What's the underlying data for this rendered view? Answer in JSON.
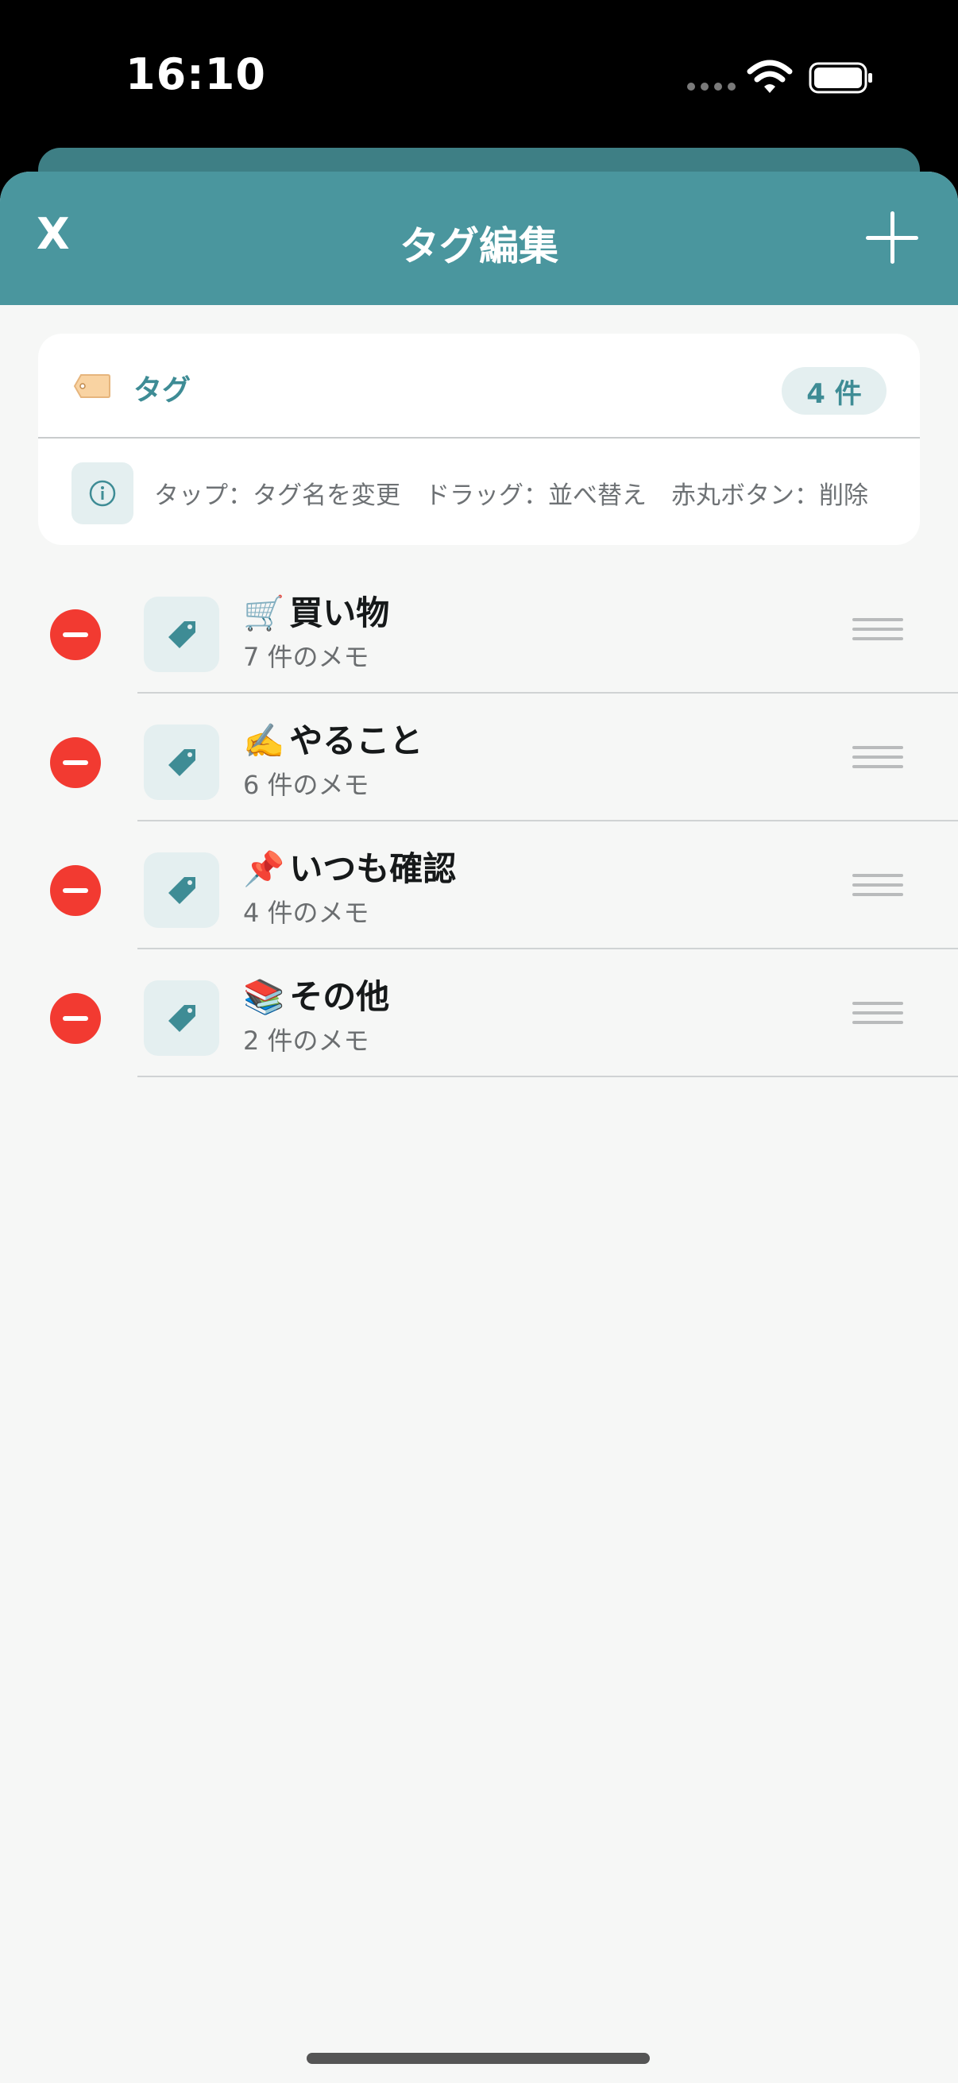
{
  "status_bar": {
    "time": "16:10",
    "icons": [
      "cellular-signal-icon",
      "wifi-icon",
      "battery-icon"
    ]
  },
  "navbar": {
    "close_label": "X",
    "title": "タグ編集",
    "add_icon": "plus-icon",
    "background_color": "#4a969e"
  },
  "tag_card": {
    "title": "タグ",
    "title_icon": "label-icon",
    "count_badge": "4 件",
    "info_icon": "info-icon",
    "help_text": "タップ：タグ名を変更　ドラッグ：並べ替え　赤丸ボタン：削除"
  },
  "tags": [
    {
      "emoji": "🛒",
      "name": "買い物",
      "count": "7 件のメモ"
    },
    {
      "emoji": "✍️",
      "name": "やること",
      "count": "6 件のメモ"
    },
    {
      "emoji": "📌",
      "name": "いつも確認",
      "count": "4 件のメモ"
    },
    {
      "emoji": "📚",
      "name": "その他",
      "count": "2 件のメモ"
    }
  ],
  "colors": {
    "accent": "#3e8c95",
    "delete": "#f23a31",
    "background": "#f6f7f6"
  }
}
